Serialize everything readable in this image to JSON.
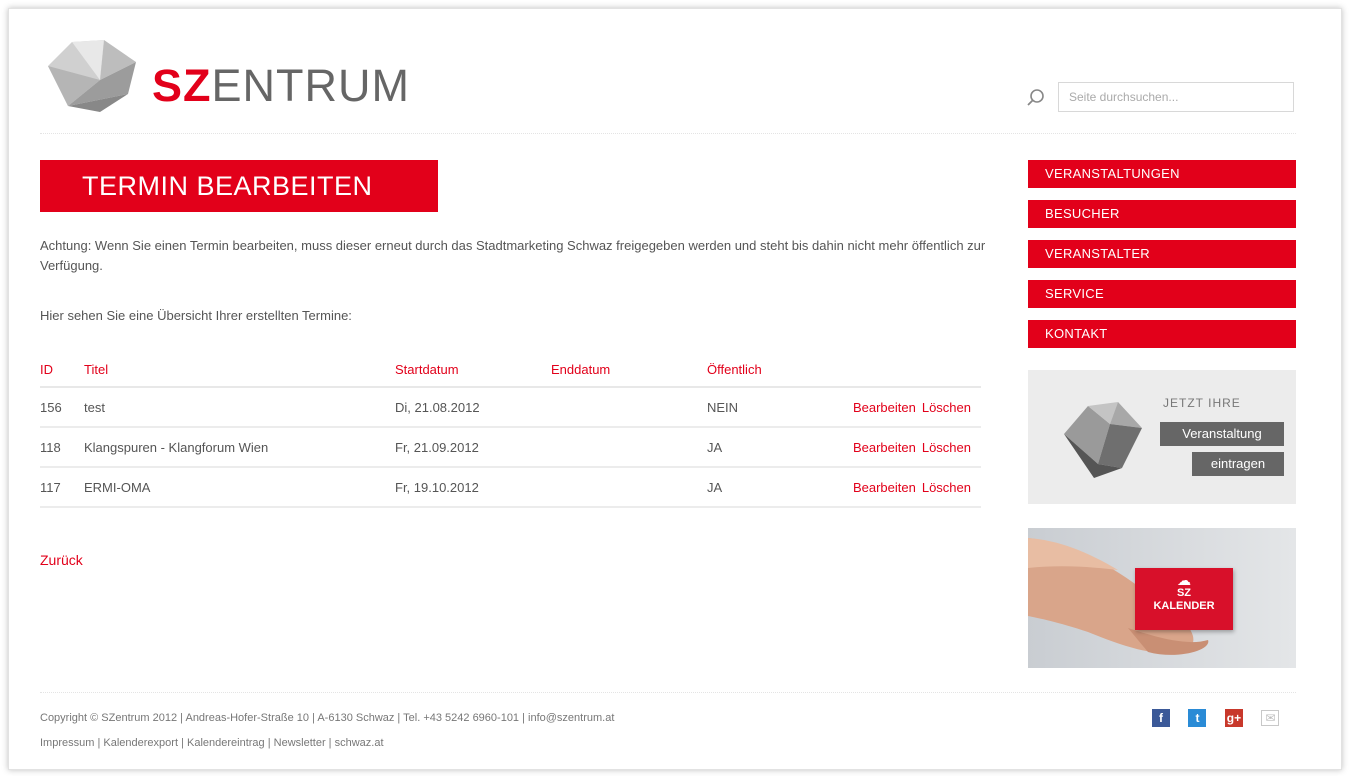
{
  "brand": {
    "prefix": "SZ",
    "suffix": "ENTRUM"
  },
  "search": {
    "placeholder": "Seite durchsuchen..."
  },
  "page": {
    "title": "TERMIN BEARBEITEN",
    "notice": "Achtung: Wenn Sie einen Termin bearbeiten, muss dieser erneut durch das Stadtmarketing Schwaz freigegeben werden und steht bis dahin nicht mehr öffentlich zur Verfügung.",
    "overview": "Hier sehen Sie eine Übersicht Ihrer erstellten Termine:",
    "back_label": "Zurück"
  },
  "table": {
    "headers": {
      "id": "ID",
      "title": "Titel",
      "start": "Startdatum",
      "end": "Enddatum",
      "public": "Öffentlich"
    },
    "rows": [
      {
        "id": "156",
        "title": "test",
        "start": "Di, 21.08.2012",
        "end": "",
        "public": "NEIN",
        "edit": "Bearbeiten",
        "delete": "Löschen"
      },
      {
        "id": "118",
        "title": "Klangspuren - Klangforum Wien",
        "start": "Fr, 21.09.2012",
        "end": "",
        "public": "JA",
        "edit": "Bearbeiten",
        "delete": "Löschen"
      },
      {
        "id": "117",
        "title": "ERMI-OMA",
        "start": "Fr, 19.10.2012",
        "end": "",
        "public": "JA",
        "edit": "Bearbeiten",
        "delete": "Löschen"
      }
    ]
  },
  "nav": {
    "items": [
      "VERANSTALTUNGEN",
      "BESUCHER",
      "VERANSTALTER",
      "SERVICE",
      "KONTAKT"
    ]
  },
  "promo": {
    "caption": "JETZT IHRE",
    "line1": "Veranstaltung",
    "line2": "eintragen"
  },
  "calendar": {
    "line1": "SZ",
    "line2": "KALENDER"
  },
  "footer": {
    "copyright": "Copyright © SZentrum 2012 | Andreas-Hofer-Straße 10 | A-6130 Schwaz | Tel. +43 5242 6960-101 | info@szentrum.at",
    "links": [
      "Impressum",
      "Kalenderexport",
      "Kalendereintrag",
      "Newsletter",
      "schwaz.at"
    ]
  },
  "social": [
    "facebook-icon",
    "twitter-icon",
    "googleplus-icon",
    "mail-icon"
  ],
  "colors": {
    "accent": "#e2001a",
    "text": "#555555",
    "promo_bg": "#ececec"
  }
}
